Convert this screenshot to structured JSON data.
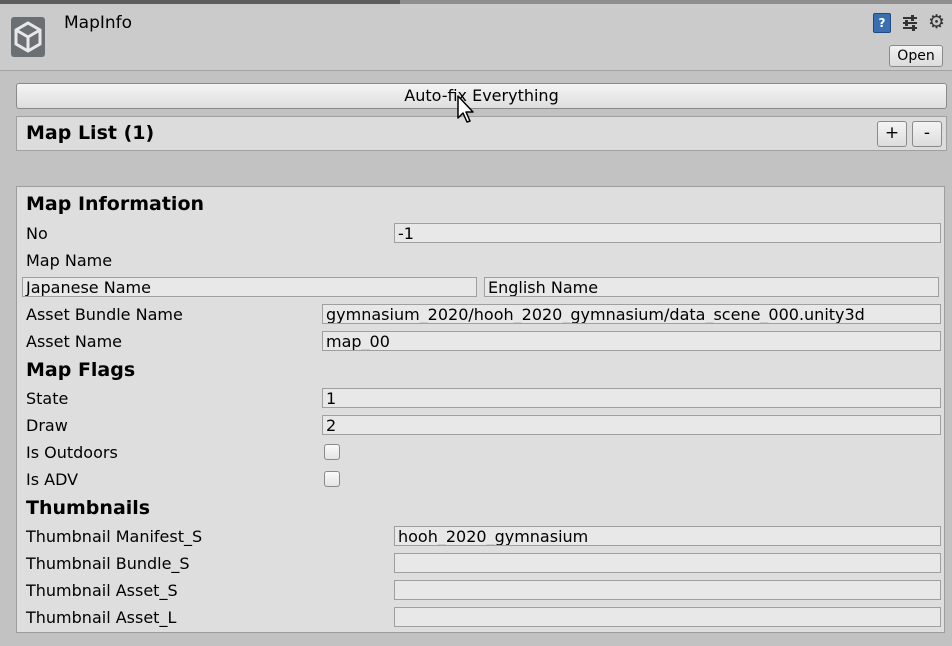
{
  "header": {
    "title": "MapInfo",
    "open_label": "Open",
    "help_glyph": "?",
    "icons": {
      "component": "unity-logo-icon",
      "help": "help-icon",
      "presets": "preset-icon",
      "settings": "gear-icon"
    }
  },
  "toolbar": {
    "autofix_label": "Auto-fix Everything"
  },
  "map_list": {
    "label": "Map List (1)",
    "add_label": "+",
    "remove_label": "-"
  },
  "map_information": {
    "heading": "Map Information",
    "no_label": "No",
    "no_value": "-1",
    "map_name_label": "Map Name",
    "japanese_name_value": "Japanese Name",
    "english_name_value": "English Name",
    "asset_bundle_label": "Asset Bundle Name",
    "asset_bundle_value": "gymnasium_2020/hooh_2020_gymnasium/data_scene_000.unity3d",
    "asset_name_label": "Asset Name",
    "asset_name_value": "map_00"
  },
  "map_flags": {
    "heading": "Map Flags",
    "state_label": "State",
    "state_value": "1",
    "draw_label": "Draw",
    "draw_value": "2",
    "outdoors_label": "Is Outdoors",
    "outdoors_checked": false,
    "adv_label": "Is ADV",
    "adv_checked": false
  },
  "thumbnails": {
    "heading": "Thumbnails",
    "manifest_s_label": "Thumbnail Manifest_S",
    "manifest_s_value": "hooh_2020_gymnasium",
    "bundle_s_label": "Thumbnail Bundle_S",
    "bundle_s_value": "",
    "asset_s_label": "Thumbnail Asset_S",
    "asset_s_value": "",
    "asset_l_label": "Thumbnail Asset_L",
    "asset_l_value": ""
  },
  "colors": {
    "window_bg": "#c2c2c2",
    "panel_bg": "#dedede",
    "field_bg": "#e8e8e8",
    "help_blue": "#3a6fb0"
  }
}
